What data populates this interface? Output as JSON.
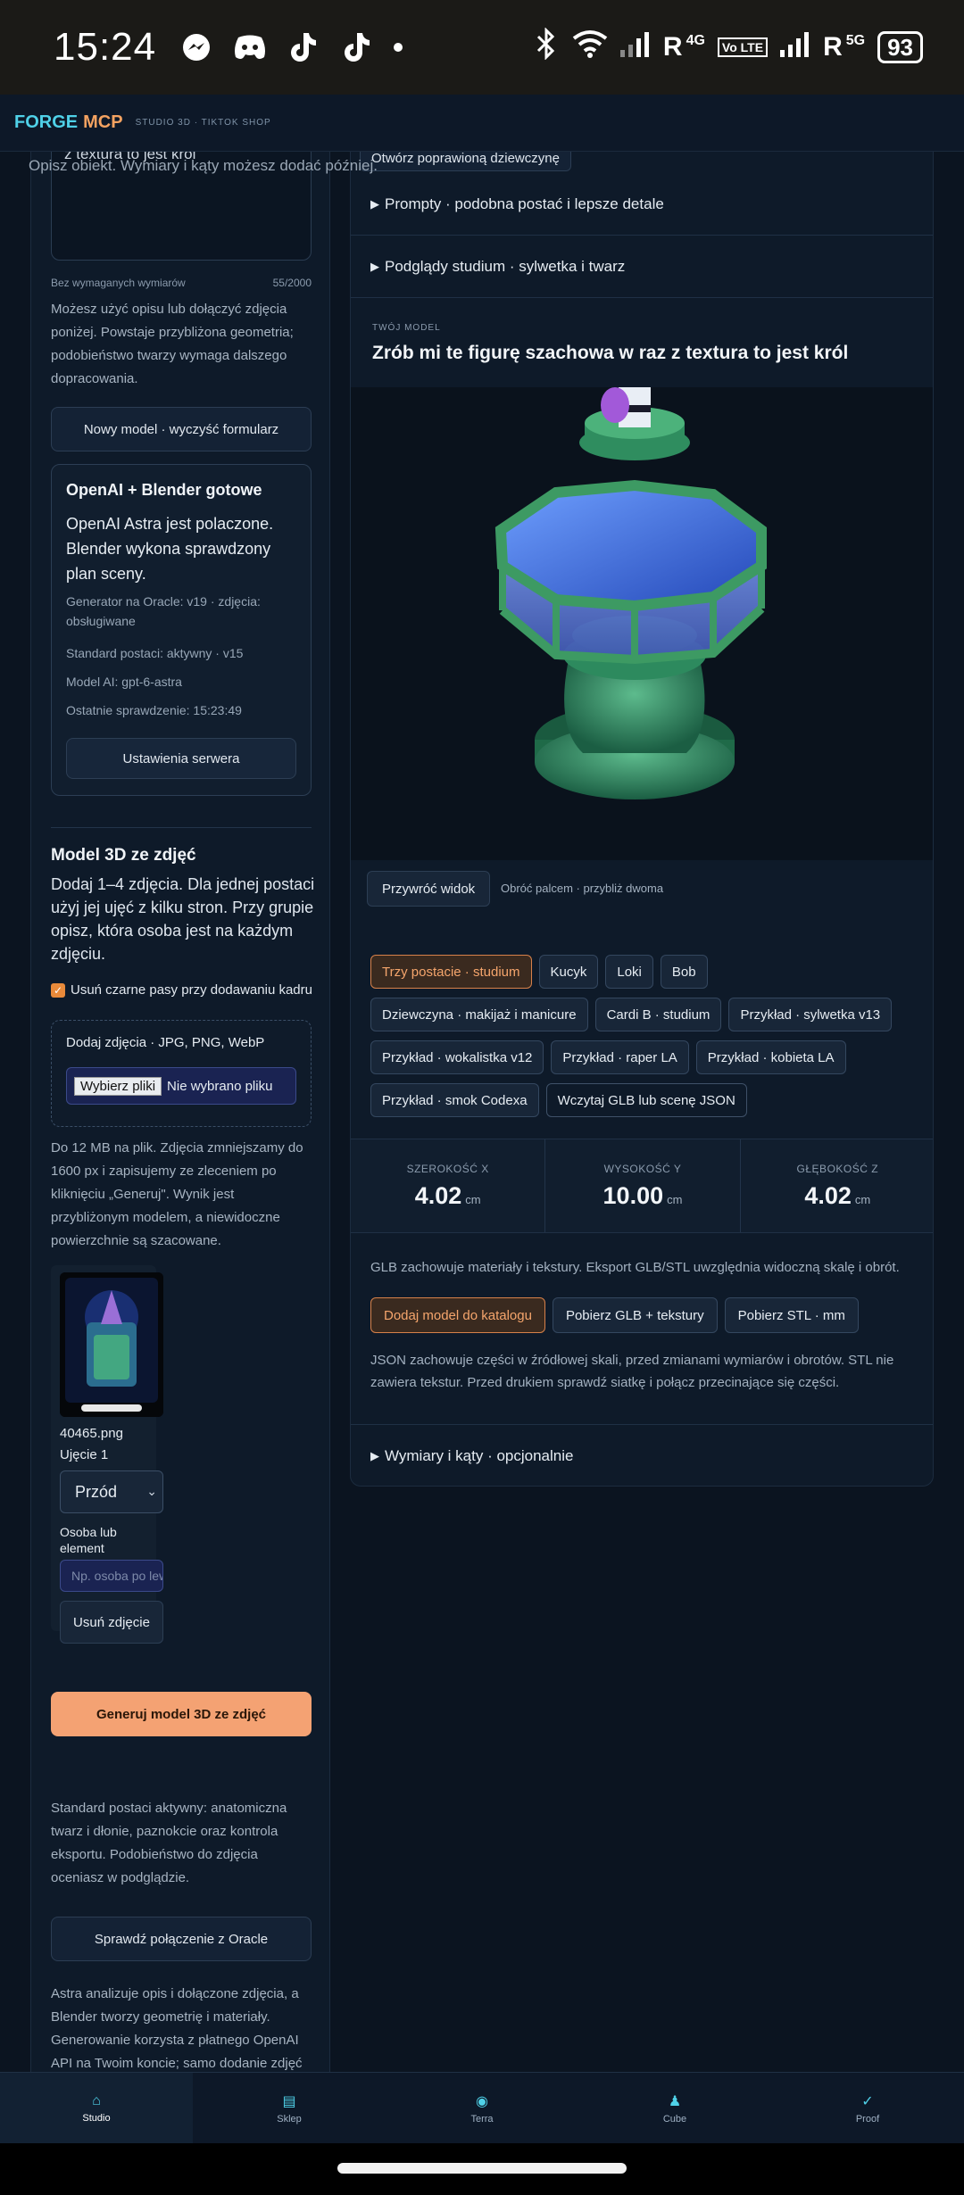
{
  "status": {
    "time": "15:24",
    "network_r1": "R",
    "net_4g": "4G",
    "volte": "Vo LTE",
    "network_r2": "R",
    "net_5g": "5G",
    "battery": "93"
  },
  "header": {
    "brand_a": "FORGE",
    "brand_b": "MCP",
    "subtitle": "STUDIO 3D · TIKTOK SHOP"
  },
  "left": {
    "description_value": "z textura to jest król",
    "description_placeholder": "Opisz obiekt. Wymiary i kąty możesz dodać później.",
    "dims_hint": "Bez wymaganych wymiarów",
    "char_count": "55/2000",
    "intro_text": "Możesz użyć opisu lub dołączyć zdjęcia poniżej. Powstaje przybliżona geometria; podobieństwo twarzy wymaga dalszego dopracowania.",
    "new_model_button": "Nowy model · wyczyść formularz",
    "status_card": {
      "title": "OpenAI + Blender gotowe",
      "lead": "OpenAI Astra jest polaczone. Blender wykona sprawdzony plan sceny.",
      "generator": "Generator na Oracle: v19 · zdjęcia: obsługiwane",
      "standard": "Standard postaci: aktywny · v15",
      "model": "Model AI: gpt-6-astra",
      "last_check": "Ostatnie sprawdzenie: 15:23:49",
      "settings_button": "Ustawienia serwera"
    },
    "photos_title": "Model 3D ze zdjęć",
    "photos_lead": "Dodaj 1–4 zdjęcia. Dla jednej postaci użyj jej ujęć z kilku stron. Przy grupie opisz, która osoba jest na każdym zdjęciu.",
    "letterbox_label": "Usuń czarne pasy przy dodawaniu kadru",
    "upload_label": "Dodaj zdjęcia · JPG, PNG, WebP",
    "file_button": "Wybierz pliki",
    "file_status": "Nie wybrano pliku",
    "size_note": "Do 12 MB na plik. Zdjęcia zmniejszamy do 1600 px i zapisujemy ze zleceniem po kliknięciu „Generuj\". Wynik jest przybliżonym modelem, a niewidoczne powierzchnie są szacowane.",
    "photo": {
      "filename": "40465.png",
      "shot": "Ujęcie 1",
      "view": "Przód",
      "person_label": "Osoba lub element",
      "person_placeholder": "Np. osoba po lewej",
      "remove_button": "Usuń zdjęcie"
    },
    "generate_button": "Generuj model 3D ze zdjęć",
    "standard_note": "Standard postaci aktywny: anatomiczna twarz i dłonie, paznokcie oraz kontrola eksportu. Podobieństwo do zdjęcia oceniasz w podglądzie.",
    "oracle_button": "Sprawdź połączenie z Oracle",
    "astra_note": "Astra analizuje opis i dołączone zdjęcia, a Blender tworzy geometrię i materiały. Generowanie korzysta z płatnego OpenAI API na Twoim koncie; samo dodanie zdjęć"
  },
  "right": {
    "open_fixed_chip": "Otwórz poprawioną dziewczynę",
    "prompts_summary": "Prompty · podobna postać i lepsze detale",
    "previews_summary": "Podglądy studium · sylwetka i twarz",
    "model_kicker": "TWÓJ MODEL",
    "model_title": "Zrób mi te figurę szachowa w raz z textura to jest król",
    "reset_button": "Przywróć widok",
    "rotate_hint": "Obróć palcem · przybliż dwoma",
    "presets": [
      "Trzy postacie · studium",
      "Kucyk",
      "Loki",
      "Bob",
      "Dziewczyna · makijaż i manicure",
      "Cardi B · studium",
      "Przykład · sylwetka v13",
      "Przykład · wokalistka v12",
      "Przykład · raper LA",
      "Przykład · kobieta LA",
      "Przykład · smok Codexa",
      "Wczytaj GLB lub scenę JSON"
    ],
    "dimensions": [
      {
        "label": "SZEROKOŚĆ X",
        "value": "4.02",
        "unit": "cm"
      },
      {
        "label": "WYSOKOŚĆ Y",
        "value": "10.00",
        "unit": "cm"
      },
      {
        "label": "GŁĘBOKOŚĆ Z",
        "value": "4.02",
        "unit": "cm"
      }
    ],
    "glb_note": "GLB zachowuje materiały i tekstury. Eksport GLB/STL uwzględnia widoczną skalę i obrót.",
    "add_catalog_button": "Dodaj model do katalogu",
    "download_glb_button": "Pobierz GLB + tekstury",
    "download_stl_button": "Pobierz STL · mm",
    "json_note": "JSON zachowuje części w źródłowej skali, przed zmianami wymiarów i obrotów. STL nie zawiera tekstur. Przed drukiem sprawdź siatkę i połącz przecinające się części.",
    "dims_summary": "Wymiary i kąty · opcjonalnie"
  },
  "nav": [
    {
      "label": "Studio",
      "icon": "home-icon"
    },
    {
      "label": "Sklep",
      "icon": "shop-icon"
    },
    {
      "label": "Terra",
      "icon": "globe-icon"
    },
    {
      "label": "Cube",
      "icon": "chess-piece-icon"
    },
    {
      "label": "Proof",
      "icon": "check-icon"
    }
  ]
}
